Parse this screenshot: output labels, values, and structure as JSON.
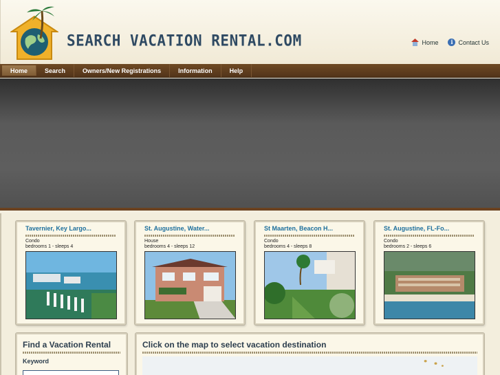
{
  "header": {
    "brand": "SEARCH VACATION RENTAL.COM",
    "links": [
      {
        "label": "Home",
        "icon": "home-icon"
      },
      {
        "label": "Contact Us",
        "icon": "info-icon"
      }
    ]
  },
  "nav": {
    "items": [
      {
        "label": "Home",
        "active": true
      },
      {
        "label": "Search"
      },
      {
        "label": "Owners/New Registrations"
      },
      {
        "label": "Information"
      },
      {
        "label": "Help"
      }
    ]
  },
  "listings": [
    {
      "title": "Tavernier, Key Largo...",
      "type": "Condo",
      "beds": "bedrooms 1 - sleeps 4"
    },
    {
      "title": "St. Augustine, Water...",
      "type": "House",
      "beds": "bedrooms 4 - sleeps 12"
    },
    {
      "title": "St Maarten, Beacon H...",
      "type": "Condo",
      "beds": "bedrooms 4 - sleeps 8"
    },
    {
      "title": "St. Augustine, FL-Fo...",
      "type": "Condo",
      "beds": "bedrooms 2 - sleeps 6"
    }
  ],
  "find_panel": {
    "title": "Find a Vacation Rental",
    "keyword_label": "Keyword",
    "keyword_value": ""
  },
  "map_panel": {
    "title": "Click on the map to select vacation destination"
  },
  "colors": {
    "nav": "#5f3f20",
    "accent": "#1d6f9d",
    "banner": "#555555"
  }
}
